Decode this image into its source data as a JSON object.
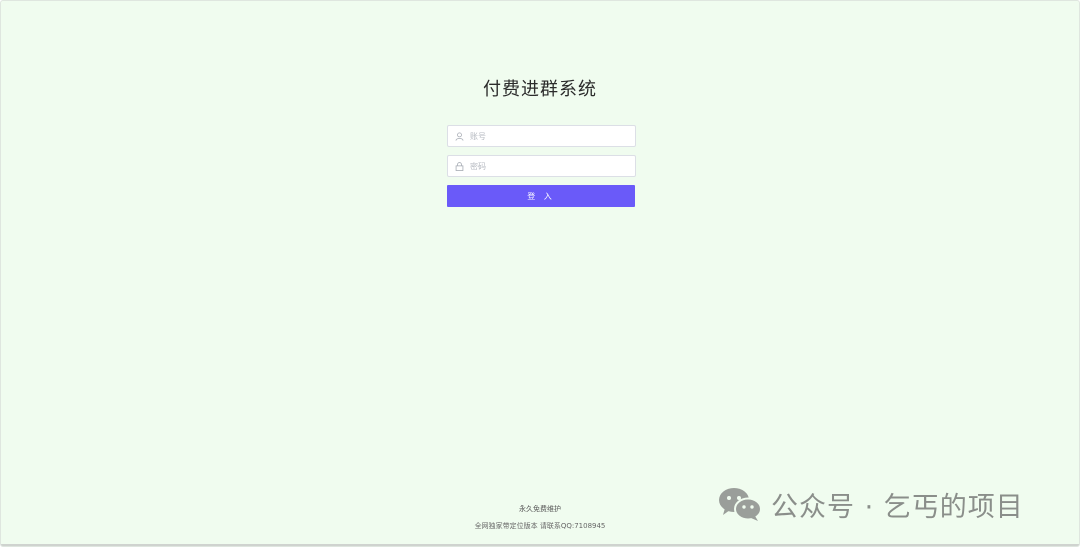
{
  "login": {
    "title": "付费进群系统",
    "username_placeholder": "账号",
    "password_placeholder": "密码",
    "username_icon": "user-icon",
    "password_icon": "lock-icon",
    "submit_label": "登 入"
  },
  "footer": {
    "line1": "永久免费维护",
    "line2": "全网独家带定位版本 请联系QQ:7108945"
  },
  "watermark": {
    "icon": "wechat-icon",
    "text": "公众号 · 乞丐的项目"
  },
  "colors": {
    "background": "#f0fcef",
    "button": "#6a5af9"
  }
}
